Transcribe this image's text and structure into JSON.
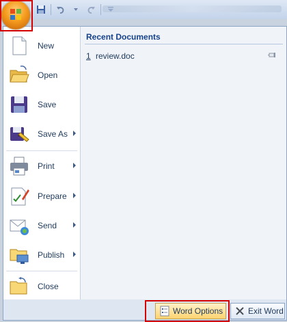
{
  "menu": {
    "items": [
      {
        "label": "New",
        "has_submenu": false
      },
      {
        "label": "Open",
        "has_submenu": false
      },
      {
        "label": "Save",
        "has_submenu": false
      },
      {
        "label": "Save As",
        "has_submenu": true
      },
      {
        "label": "Print",
        "has_submenu": true
      },
      {
        "label": "Prepare",
        "has_submenu": true
      },
      {
        "label": "Send",
        "has_submenu": true
      },
      {
        "label": "Publish",
        "has_submenu": true
      },
      {
        "label": "Close",
        "has_submenu": false
      }
    ]
  },
  "recent": {
    "header": "Recent Documents",
    "items": [
      {
        "number": "1",
        "name": "review.doc"
      }
    ]
  },
  "bottom": {
    "word_options_label": "Word Options",
    "exit_word_label": "Exit Word"
  },
  "colors": {
    "accent_text": "#15428b",
    "highlight_border": "#d40000",
    "word_options_bg": "#ffd470"
  }
}
